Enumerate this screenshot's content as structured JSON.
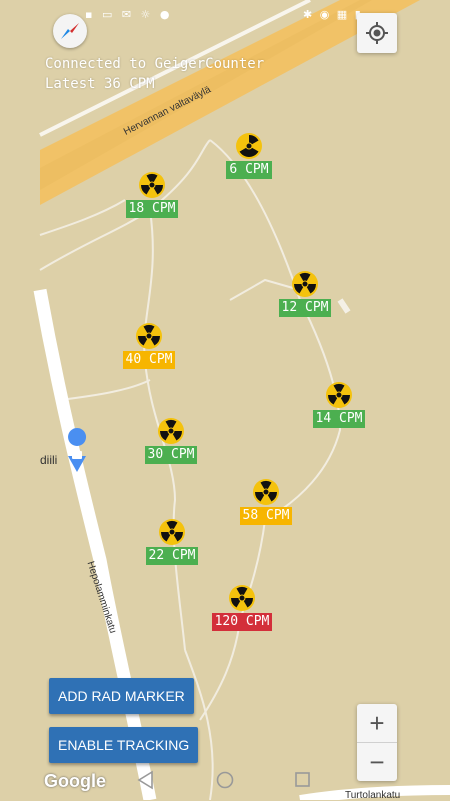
{
  "header": {
    "connection_text": "Connected to GeigerCounter",
    "latest_text": "Latest 36 CPM"
  },
  "map": {
    "street_labels": [
      "Hervannan valtaväylä",
      "Hepolamminkatu",
      "Turtolankatu",
      "diili"
    ],
    "attribution": "Google"
  },
  "markers": [
    {
      "label": "6 CPM",
      "level": "green"
    },
    {
      "label": "18 CPM",
      "level": "green"
    },
    {
      "label": "12 CPM",
      "level": "green"
    },
    {
      "label": "40 CPM",
      "level": "orange"
    },
    {
      "label": "14 CPM",
      "level": "green"
    },
    {
      "label": "30 CPM",
      "level": "green"
    },
    {
      "label": "58 CPM",
      "level": "orange"
    },
    {
      "label": "22 CPM",
      "level": "green"
    },
    {
      "label": "120 CPM",
      "level": "red"
    }
  ],
  "buttons": {
    "add_marker": "ADD RAD MARKER",
    "tracking": "ENABLE TRACKING"
  },
  "zoom": {
    "in": "+",
    "out": "−"
  },
  "colors": {
    "map_bg": "#ddd0a8",
    "highway": "#f2c464",
    "button": "#2f71b5",
    "green": "#4caf50",
    "orange": "#f7b500",
    "red": "#d32f3a"
  },
  "icons": [
    "compass-icon",
    "my-location-icon",
    "radiation-icon",
    "shopping-place-icon",
    "back-nav-icon",
    "home-nav-icon",
    "recents-nav-icon"
  ]
}
